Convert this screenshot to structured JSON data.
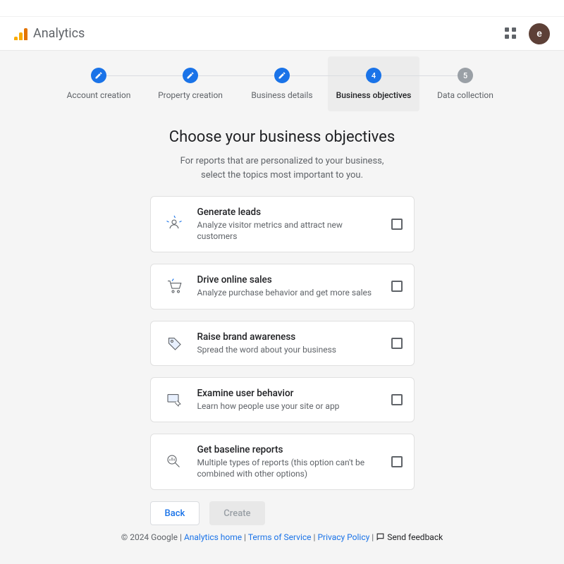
{
  "header": {
    "product": "Analytics",
    "avatar_letter": "e"
  },
  "stepper": {
    "s1": "Account creation",
    "s2": "Property creation",
    "s3": "Business details",
    "s4": "Business objectives",
    "s5": "Data collection",
    "num4": "4",
    "num5": "5"
  },
  "page": {
    "title": "Choose your business objectives",
    "sub1": "For reports that are personalized to your business,",
    "sub2": "select the topics most important to you."
  },
  "cards": {
    "c1t": "Generate leads",
    "c1d": "Analyze visitor metrics and attract new customers",
    "c2t": "Drive online sales",
    "c2d": "Analyze purchase behavior and get more sales",
    "c3t": "Raise brand awareness",
    "c3d": "Spread the word about your business",
    "c4t": "Examine user behavior",
    "c4d": "Learn how people use your site or app",
    "c5t": "Get baseline reports",
    "c5d": "Multiple types of reports (this option can't be combined with other options)"
  },
  "buttons": {
    "back": "Back",
    "create": "Create"
  },
  "legal": {
    "copyright": "© 2024 Google",
    "analytics_home": "Analytics home",
    "tos": "Terms of Service",
    "privacy": "Privacy Policy",
    "feedback": "Send feedback"
  }
}
